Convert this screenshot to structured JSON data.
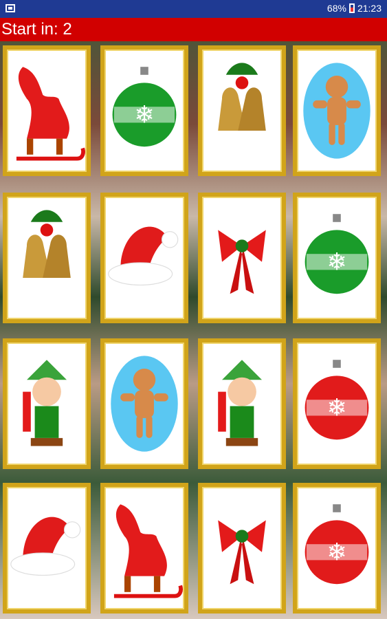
{
  "status_bar": {
    "battery": "68%",
    "time": "21:23"
  },
  "header": {
    "countdown_text": "Start in: 2"
  },
  "board": {
    "rows": [
      [
        "sleigh",
        "green-ornament",
        "bells",
        "gingerbread"
      ],
      [
        "bells",
        "santa-hat",
        "bow",
        "green-ornament"
      ],
      [
        "elf",
        "gingerbread",
        "elf",
        "red-ornament"
      ],
      [
        "santa-hat",
        "sleigh",
        "bow",
        "red-ornament"
      ]
    ]
  },
  "colors": {
    "status_bar": "#1f3a93",
    "header": "#d10000",
    "card_border": "#d1a41a"
  }
}
